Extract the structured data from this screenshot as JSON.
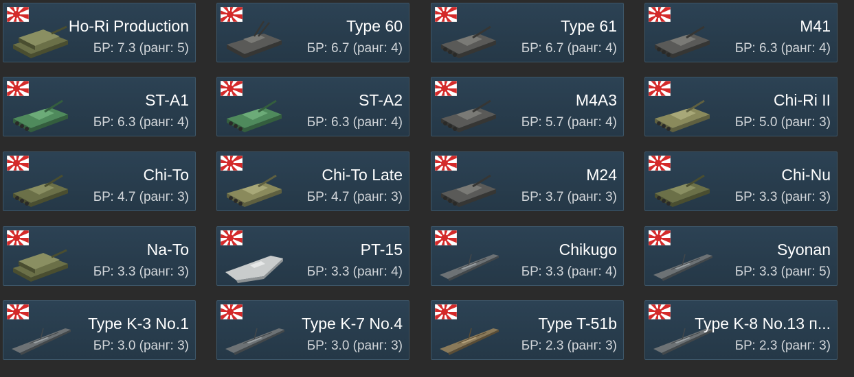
{
  "flag_icon": "japan-rising-sun-flag-icon",
  "colors": {
    "background": "#2b2b2b",
    "card": "#2b4153",
    "card_border": "#3d5668",
    "name_text": "#ffffff",
    "br_text": "#d2d6da",
    "flag_red": "#d42a2a"
  },
  "vehicles": [
    {
      "name": "Ho-Ri Production",
      "br": "БР: 7.3 (ранг: 5)",
      "icon": "spg-tank-icon",
      "kind": "spg",
      "hue": "olive"
    },
    {
      "name": "Type 60",
      "br": "БР: 6.7 (ранг: 4)",
      "icon": "spaa-tank-icon",
      "kind": "spaa",
      "hue": "dark"
    },
    {
      "name": "Type 61",
      "br": "БР: 6.7 (ранг: 4)",
      "icon": "tank-icon",
      "kind": "tank",
      "hue": "dark"
    },
    {
      "name": "M41",
      "br": "БР: 6.3 (ранг: 4)",
      "icon": "tank-icon",
      "kind": "tank",
      "hue": "dark"
    },
    {
      "name": "ST-A1",
      "br": "БР: 6.3 (ранг: 4)",
      "icon": "tank-icon",
      "kind": "tank",
      "hue": "green"
    },
    {
      "name": "ST-A2",
      "br": "БР: 6.3 (ранг: 4)",
      "icon": "tank-icon",
      "kind": "tank",
      "hue": "green"
    },
    {
      "name": "M4A3",
      "br": "БР: 5.7 (ранг: 4)",
      "icon": "tank-icon",
      "kind": "tank",
      "hue": "dark"
    },
    {
      "name": "Chi-Ri II",
      "br": "БР: 5.0 (ранг: 3)",
      "icon": "tank-icon",
      "kind": "tank",
      "hue": "khaki"
    },
    {
      "name": "Chi-To",
      "br": "БР: 4.7 (ранг: 3)",
      "icon": "tank-icon",
      "kind": "tank",
      "hue": "olive"
    },
    {
      "name": "Chi-To Late",
      "br": "БР: 4.7 (ранг: 3)",
      "icon": "tank-icon",
      "kind": "tank",
      "hue": "khaki"
    },
    {
      "name": "M24",
      "br": "БР: 3.7 (ранг: 3)",
      "icon": "tank-icon",
      "kind": "tank",
      "hue": "dark"
    },
    {
      "name": "Chi-Nu",
      "br": "БР: 3.3 (ранг: 3)",
      "icon": "tank-icon",
      "kind": "tank",
      "hue": "olive"
    },
    {
      "name": "Na-To",
      "br": "БР: 3.3 (ранг: 3)",
      "icon": "spg-tank-icon",
      "kind": "spg",
      "hue": "olive"
    },
    {
      "name": "PT-15",
      "br": "БР: 3.3 (ранг: 4)",
      "icon": "boat-icon",
      "kind": "boat",
      "hue": "light"
    },
    {
      "name": "Chikugo",
      "br": "БР: 3.3 (ранг: 4)",
      "icon": "ship-icon",
      "kind": "ship",
      "hue": "grey"
    },
    {
      "name": "Syonan",
      "br": "БР: 3.3 (ранг: 5)",
      "icon": "ship-icon",
      "kind": "ship",
      "hue": "grey"
    },
    {
      "name": "Type K-3 No.1",
      "br": "БР: 3.0 (ранг: 3)",
      "icon": "ship-icon",
      "kind": "ship",
      "hue": "grey"
    },
    {
      "name": "Type K-7 No.4",
      "br": "БР: 3.0 (ранг: 3)",
      "icon": "ship-icon",
      "kind": "ship",
      "hue": "grey"
    },
    {
      "name": "Type T-51b",
      "br": "БР: 2.3 (ранг: 3)",
      "icon": "ship-icon",
      "kind": "ship",
      "hue": "wood"
    },
    {
      "name": "Type K-8 No.13 п...",
      "br": "БР: 2.3 (ранг: 3)",
      "icon": "ship-icon",
      "kind": "ship",
      "hue": "grey"
    }
  ]
}
